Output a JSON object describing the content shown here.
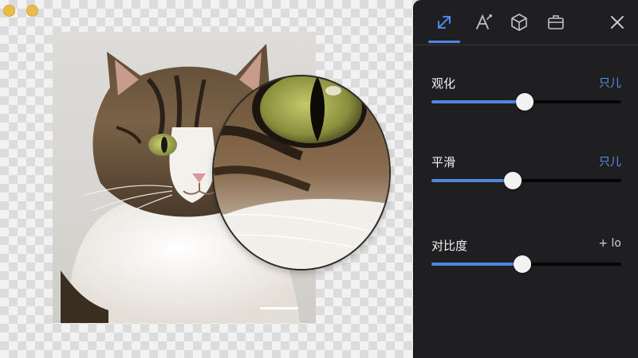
{
  "window": {
    "buttons": [
      "minimize",
      "zoom"
    ]
  },
  "canvas": {
    "image": "cat-portrait",
    "loupe": "eye-magnifier"
  },
  "panel": {
    "tools": [
      {
        "icon": "resize-arrow-icon",
        "active": true
      },
      {
        "icon": "text-style-icon",
        "active": false
      },
      {
        "icon": "cube-icon",
        "active": false
      },
      {
        "icon": "briefcase-icon",
        "active": false
      }
    ],
    "close_icon": "close-icon",
    "adjustments": [
      {
        "label": "观化",
        "action": "只儿",
        "value": 0.49
      },
      {
        "label": "平滑",
        "action": "只儿",
        "value": 0.43
      },
      {
        "label": "对比度",
        "action": "+ lo",
        "value": 0.48
      }
    ],
    "accent": "#4a87e6"
  }
}
